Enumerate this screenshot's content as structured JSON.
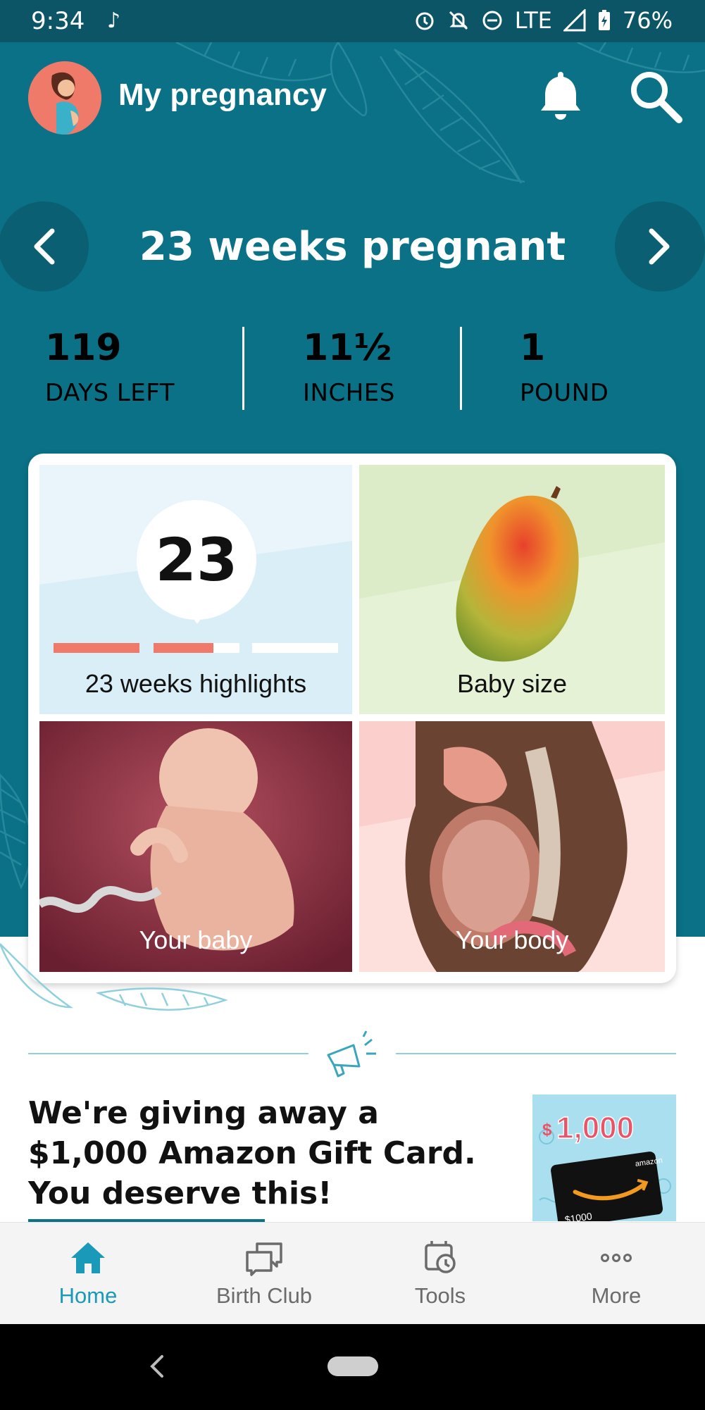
{
  "status_bar": {
    "time": "9:34",
    "network": "LTE",
    "battery": "76%"
  },
  "header": {
    "title": "My pregnancy"
  },
  "week_nav": {
    "title": "23 weeks pregnant",
    "prev_icon": "chevron-left-icon",
    "next_icon": "chevron-right-icon"
  },
  "stats": [
    {
      "value": "119",
      "label": "DAYS LEFT"
    },
    {
      "value": "11½",
      "label": "INCHES"
    },
    {
      "value": "1",
      "label": "POUND"
    }
  ],
  "tiles": {
    "highlights": {
      "week_number": "23",
      "label": "23 weeks highlights",
      "progress_segments": [
        1,
        0.7,
        0
      ]
    },
    "baby_size": {
      "label": "Baby size"
    },
    "your_baby": {
      "label": "Your baby"
    },
    "your_body": {
      "label": "Your body"
    }
  },
  "promo": {
    "text": "We're giving away a $1,000 Amazon Gift Card. You deserve this!",
    "image_amount": "$1,000",
    "image_brand": "amazon",
    "image_card_value": "$1000"
  },
  "bottom_nav": {
    "items": [
      {
        "label": "Home",
        "icon": "home-icon",
        "active": true
      },
      {
        "label": "Birth Club",
        "icon": "chat-bubbles-icon",
        "active": false
      },
      {
        "label": "Tools",
        "icon": "tools-icon",
        "active": false
      },
      {
        "label": "More",
        "icon": "more-dots-icon",
        "active": false
      }
    ]
  },
  "colors": {
    "header_teal": "#0a7186",
    "status_teal": "#0b5566",
    "accent_coral": "#f07a6a",
    "active_blue": "#1a9ab8"
  }
}
